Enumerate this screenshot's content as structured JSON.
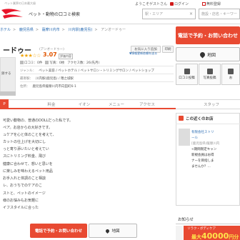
{
  "header": {
    "brand_tag": "ペット業界の日本最大級",
    "site_title": "ペット・動物の口コミ検索",
    "welcome": "ようこそゲストさん",
    "login": "ログイン",
    "register": "無料登録",
    "area_placeholder": "駅・エリア",
    "area_clear": "×",
    "keyword_placeholder": "施設・店名・キーワー"
  },
  "breadcrumb": [
    "ホテル",
    "鹿児島県",
    "薩摩川内市",
    "川内駅(鹿児島)",
    "アンオードゥー"
  ],
  "share_label": "共有",
  "store": {
    "name": "ードゥー",
    "kana": "(アンオードゥー)",
    "fav_label": "お気に入り追加",
    "print_label": "印刷",
    "thumb_label": "録する",
    "stars": "★★★☆☆",
    "rating": "3.07",
    "rating_badge": "評価内容",
    "edit_tag": "▼情報更新依頼を送る",
    "counts": [
      "口コミ：0件",
      "写真：0枚",
      "アクセス数：26(先月)"
    ],
    "genre_label": "ジャンル：",
    "genre": "ペット美容 / ペットホテル / ペットサロン・トリミングサロン / ペットショップ",
    "station_label": "最寄駅：",
    "station": "川内駅(鹿児島) / 隈之城駅",
    "address_label": "住所：",
    "address": "鹿児島県薩摩川内市向田町6-1"
  },
  "actions": {
    "call": "電話で予約・お問い合わせ",
    "map": "地図",
    "review": "口コミ投稿",
    "photo": "写真投稿",
    "tile3": "お"
  },
  "tabs": [
    "P",
    "料金",
    "イオン",
    "メニュー",
    "アクセス",
    "スタッフ"
  ],
  "description": [
    "可愛い動物の、普通のDOLLだった私です。",
    "ペア。お店からの大好きです。",
    "ュケアを心と体のことを考えて、",
    "カットの仕上げを大切にし",
    "っと寄り添いたいと考えてい",
    "スにトリミング料金、飛び",
    "健康に合わせて、想いと思いを",
    "に楽しみを味わえるペット用品",
    "お手入れと体調のこと相談",
    "レ、おうちでのケアのこ",
    "ストと、ペットのイメージ",
    "様のお悩みもお気軽に",
    "イフスタイルに合った"
  ],
  "bottom": {
    "call": "電話で予約・お問い合わせ",
    "map": "地図"
  },
  "sidebar": {
    "recommend_title": "この近くのお店",
    "company": "有限会社ストリ",
    "company_sub": "ール",
    "tag": "[鹿児島県/薩摩川内",
    "campaign": "<期間限定キャン",
    "campaign2": "新規会員はお得",
    "link1": "ナーを目指しま",
    "link2": "ませんか？…",
    "notice_title": "お知らせ",
    "promo_line1": "リラク・ボディケア",
    "promo_prefix": "最大",
    "promo_amount": "40000",
    "promo_suffix": "円分"
  }
}
